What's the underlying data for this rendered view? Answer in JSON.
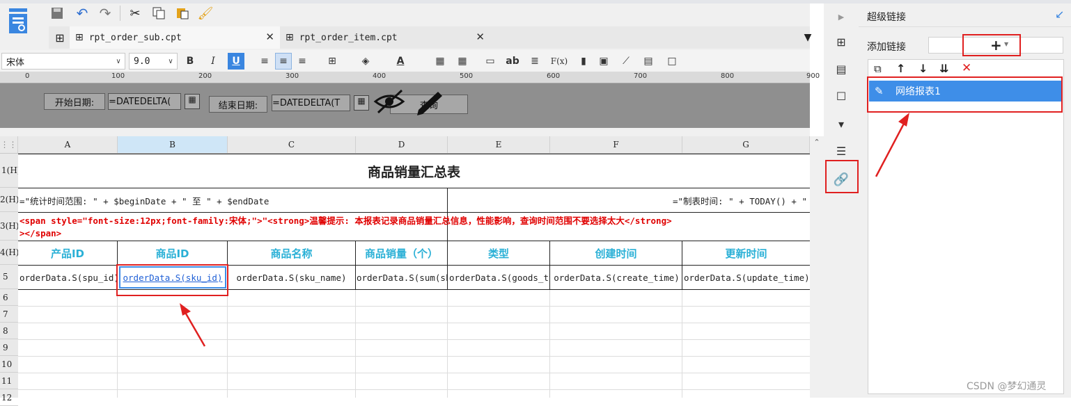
{
  "toolbar": {
    "icons": [
      "template-icon",
      "save-icon",
      "undo-icon",
      "redo-icon",
      "cut-icon",
      "copy-icon",
      "paste-icon",
      "format-brush-icon"
    ]
  },
  "tabs": [
    {
      "label": "rpt_order_sub.cpt",
      "active": true
    },
    {
      "label": "rpt_order_item.cpt",
      "active": false
    }
  ],
  "format": {
    "font": "宋体",
    "size": "9.0",
    "bold": "B",
    "italic": "I",
    "underline": "U",
    "text_button": "ab",
    "formula_button": "F(x)"
  },
  "ruler": {
    "ticks": [
      "0",
      "100",
      "200",
      "300",
      "400",
      "500",
      "600",
      "700",
      "800",
      "900"
    ]
  },
  "params": {
    "start_label": "开始日期:",
    "start_value": "=DATEDELTA(",
    "end_label": "结束日期:",
    "end_value": "=DATEDELTA(T",
    "query_label": "查询"
  },
  "grid": {
    "columns": [
      "A",
      "B",
      "C",
      "D",
      "E",
      "F",
      "G"
    ],
    "rows": [
      "1(H)",
      "2(H)",
      "3(H)",
      "4(H)",
      "5",
      "6",
      "7",
      "8",
      "9",
      "10",
      "11",
      "12"
    ],
    "title": "商品销量汇总表",
    "stat_range": "=\"统计时间范围: \" + $beginDate + \" 至 \" + $endDate",
    "made_time": "=\"制表时间: \" + TODAY() + \"",
    "tip_line1": "<span style=\"font-size:12px;font-family:宋体;\">\"<strong>温馨提示: 本报表记录商品销量汇总信息，性能影响，查询时间范围不要选择太大</strong>",
    "tip_line2": "></span>",
    "headers": [
      "产品ID",
      "商品ID",
      "商品名称",
      "商品销量（个）",
      "类型",
      "创建时间",
      "更新时间"
    ],
    "data_row": [
      "orderData.S(spu_id)",
      "orderData.S(sku_id)",
      "orderData.S(sku_name)",
      "orderData.S(sum(sku_num))",
      "orderData.S(goods_type)",
      "orderData.S(create_time)",
      "orderData.S(update_time)"
    ]
  },
  "right_panel": {
    "title": "超级链接",
    "add_label": "添加链接",
    "add_button": "+",
    "link_items": [
      "网络报表1"
    ]
  },
  "watermark": "CSDN @梦幻通灵",
  "colors": {
    "accent": "#1e90ff",
    "header_text": "#2ab0d6",
    "tip_text": "#e00000",
    "highlight_blue": "#3e8ee8",
    "annotation_red": "#e02020"
  }
}
